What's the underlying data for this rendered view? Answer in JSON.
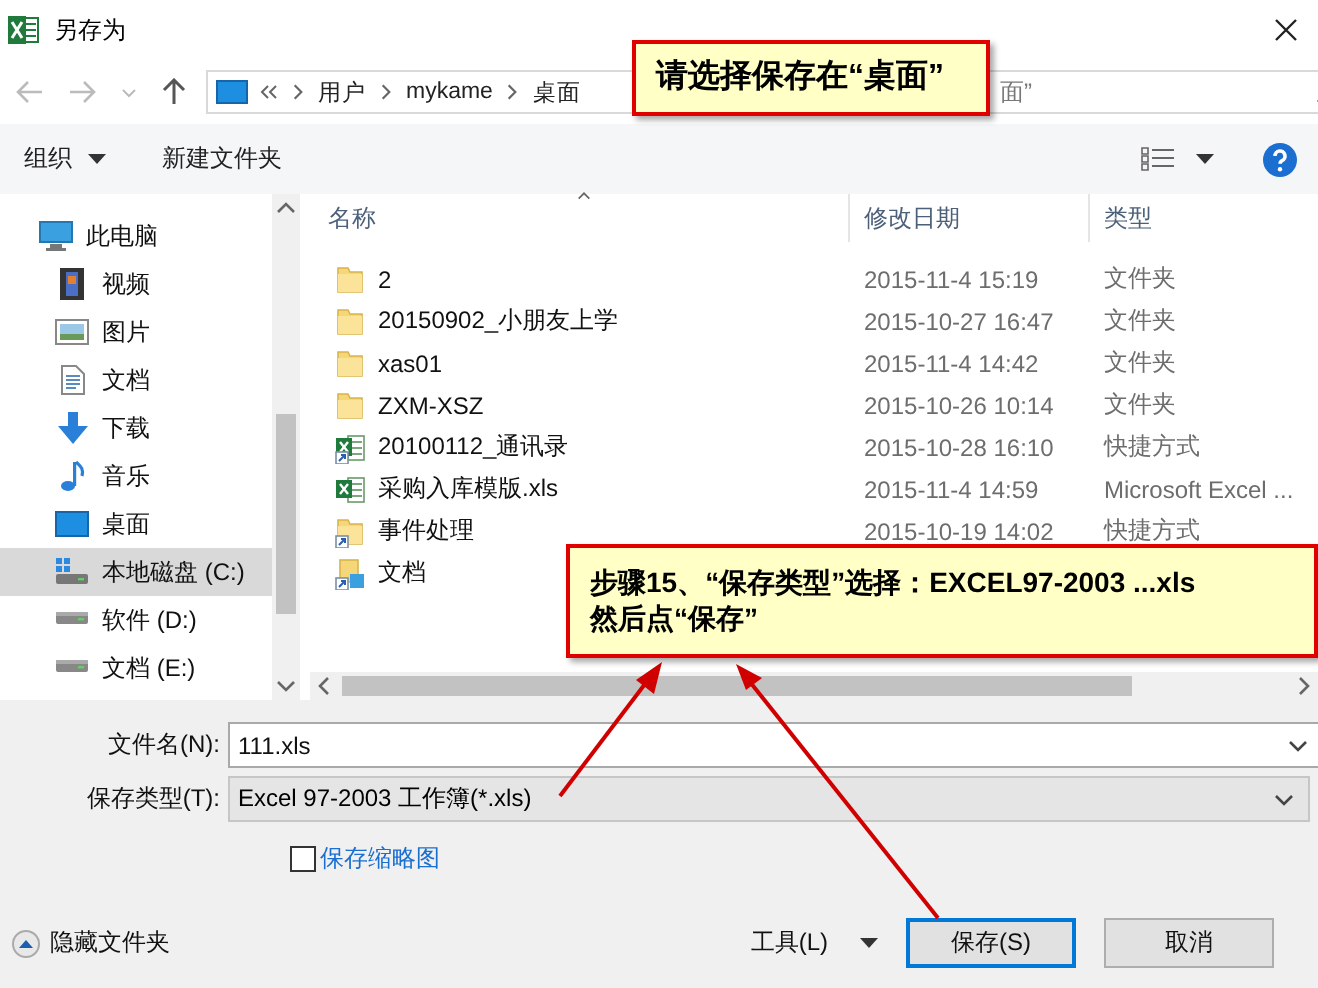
{
  "window": {
    "title": "另存为"
  },
  "address": {
    "path": [
      "用户",
      "mykame",
      "桌面"
    ]
  },
  "search": {
    "placeholder": "面”"
  },
  "toolbar": {
    "organize": "组织",
    "new_folder": "新建文件夹"
  },
  "nav_pane": {
    "items": [
      {
        "label": "此电脑",
        "kind": "pc",
        "selected": false,
        "children": [
          {
            "label": "视频",
            "kind": "video",
            "selected": false
          },
          {
            "label": "图片",
            "kind": "picture",
            "selected": false
          },
          {
            "label": "文档",
            "kind": "document",
            "selected": false
          },
          {
            "label": "下载",
            "kind": "download",
            "selected": false
          },
          {
            "label": "音乐",
            "kind": "music",
            "selected": false
          },
          {
            "label": "桌面",
            "kind": "desktop",
            "selected": false
          },
          {
            "label": "本地磁盘 (C:)",
            "kind": "system-drive",
            "selected": true
          },
          {
            "label": "软件 (D:)",
            "kind": "drive",
            "selected": false
          },
          {
            "label": "文档 (E:)",
            "kind": "drive",
            "selected": false
          }
        ]
      }
    ]
  },
  "columns": [
    "名称",
    "修改日期",
    "类型"
  ],
  "files": [
    {
      "kind": "folder",
      "name": "2",
      "date": "2015-11-4 15:19",
      "type": "文件夹",
      "selected": false
    },
    {
      "kind": "folder",
      "name": "20150902_小朋友上学",
      "date": "2015-10-27 16:47",
      "type": "文件夹",
      "selected": false
    },
    {
      "kind": "folder",
      "name": "xas01",
      "date": "2015-11-4 14:42",
      "type": "文件夹",
      "selected": false
    },
    {
      "kind": "folder",
      "name": "ZXM-XSZ",
      "date": "2015-10-26 10:14",
      "type": "文件夹",
      "selected": false
    },
    {
      "kind": "excel-shortcut",
      "name": "20100112_通讯录",
      "date": "2015-10-28 16:10",
      "type": "快捷方式",
      "selected": false
    },
    {
      "kind": "excel",
      "name": "采购入库模版.xls",
      "date": "2015-11-4 14:59",
      "type": "Microsoft Excel ...",
      "selected": false
    },
    {
      "kind": "folder-shortcut",
      "name": "事件处理",
      "date": "2015-10-19 14:02",
      "type": "快捷方式",
      "selected": false
    },
    {
      "kind": "library-shortcut",
      "name": "文档",
      "selected": false
    }
  ],
  "form": {
    "filename_label": "文件名(N):",
    "filename": "111.xls",
    "type_label": "保存类型(T):",
    "type": "Excel 97-2003 工作簿(*.xls)",
    "thumbnail": {
      "label": "保存缩略图",
      "checked": false
    }
  },
  "footer": {
    "hide_folders": "隐藏文件夹",
    "tools": "工具(L)",
    "save": "保存(S)",
    "cancel": "取消"
  },
  "callouts": [
    {
      "text": "请选择保存在“桌面”"
    },
    {
      "text": "步骤15、“保存类型”选择：EXCEL97-2003  ...xls\n然后点“保存”"
    }
  ]
}
